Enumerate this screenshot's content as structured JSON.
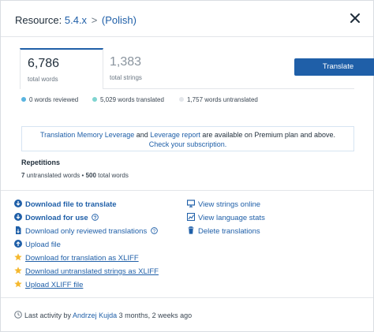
{
  "header": {
    "prefix": "Resource:",
    "resource": "5.4.x",
    "separator": ">",
    "language": "(Polish)"
  },
  "stats": {
    "total_words": {
      "value": "6,786",
      "label": "total words"
    },
    "total_strings": {
      "value": "1,383",
      "label": "total strings"
    },
    "translate_button": "Translate"
  },
  "legend": {
    "reviewed": {
      "text": "0 words reviewed",
      "color": "#5ab4e0"
    },
    "translated": {
      "text": "5,029 words translated",
      "color": "#7fd4d0"
    },
    "untranslated": {
      "text": "1,757 words untranslated",
      "color": "#e3e6ea"
    }
  },
  "notice": {
    "part1_link": "Translation Memory Leverage",
    "part2": "and",
    "part3_link": "Leverage report",
    "part4": "are available on Premium plan and above.",
    "cta_link": "Check your subscription."
  },
  "repetitions": {
    "title": "Repetitions",
    "untranslated_count": "7",
    "untranslated_label": "untranslated words",
    "bullet": "•",
    "total_count": "500",
    "total_label": "total words"
  },
  "actions_left": [
    {
      "label": "Download file to translate",
      "icon": "download-icon"
    },
    {
      "label": "Download for use",
      "icon": "download-icon"
    },
    {
      "label": "Download only reviewed translations",
      "icon": "file-download-icon"
    },
    {
      "label": "Upload file",
      "icon": "upload-icon"
    },
    {
      "label": "Download for translation as XLIFF",
      "icon": "star-icon"
    },
    {
      "label": "Download untranslated strings as XLIFF",
      "icon": "star-icon"
    },
    {
      "label": "Upload XLIFF file",
      "icon": "star-icon"
    }
  ],
  "actions_right": [
    {
      "label": "View strings online",
      "icon": "monitor-icon"
    },
    {
      "label": "View language stats",
      "icon": "chart-icon"
    },
    {
      "label": "Delete translations",
      "icon": "trash-icon"
    }
  ],
  "footer": {
    "prefix": "Last activity by",
    "user": "Andrzej Kujda",
    "time": "3 months, 2 weeks ago"
  },
  "colors": {
    "accent": "#1f5fa8",
    "star": "#f5b82e"
  }
}
